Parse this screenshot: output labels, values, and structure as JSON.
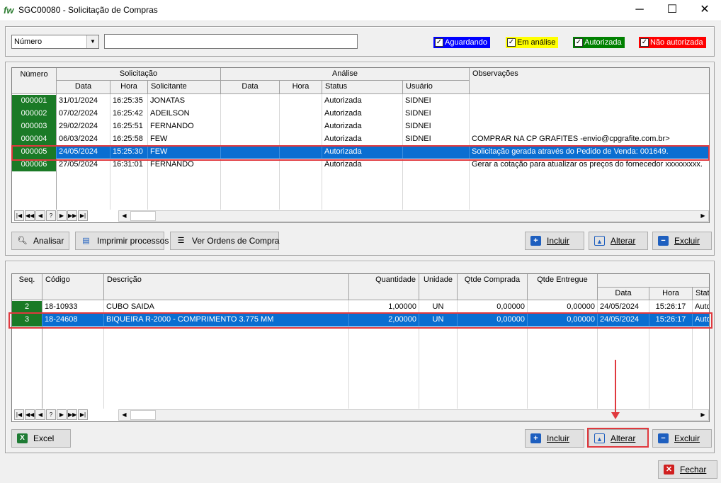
{
  "window": {
    "logo": "fw",
    "title": "SGC00080 - Solicitação de Compras",
    "minimize_glyph": "─",
    "maximize_glyph": "☐",
    "close_glyph": "✕"
  },
  "filter": {
    "field_select": "Número",
    "search_value": "",
    "statuses": [
      {
        "label": "Aguardando",
        "checked": true,
        "bg": "#0000ff",
        "fg": "#ffffff"
      },
      {
        "label": "Em análise",
        "checked": true,
        "bg": "#ffff00",
        "fg": "#000000"
      },
      {
        "label": "Autorizada",
        "checked": true,
        "bg": "#008000",
        "fg": "#ffffff"
      },
      {
        "label": "Não autorizada",
        "checked": true,
        "bg": "#ff0000",
        "fg": "#ffffff"
      }
    ]
  },
  "requests_grid": {
    "group_headers": {
      "numero": "Número",
      "solicitacao": "Solicitação",
      "analise": "Análise",
      "observacoes": "Observações"
    },
    "sub_headers": {
      "data": "Data",
      "hora": "Hora",
      "solicitante": "Solicitante",
      "an_data": "Data",
      "an_hora": "Hora",
      "status": "Status",
      "usuario": "Usuário"
    },
    "rows": [
      {
        "numero": "000001",
        "data": "31/01/2024",
        "hora": "16:25:35",
        "solicitante": "JONATAS",
        "an_data": "",
        "an_hora": "",
        "status": "Autorizada",
        "usuario": "SIDNEI",
        "obs": ""
      },
      {
        "numero": "000002",
        "data": "07/02/2024",
        "hora": "16:25:42",
        "solicitante": "ADEILSON",
        "an_data": "",
        "an_hora": "",
        "status": "Autorizada",
        "usuario": "SIDNEI",
        "obs": ""
      },
      {
        "numero": "000003",
        "data": "29/02/2024",
        "hora": "16:25:51",
        "solicitante": "FERNANDO",
        "an_data": "",
        "an_hora": "",
        "status": "Autorizada",
        "usuario": "SIDNEI",
        "obs": ""
      },
      {
        "numero": "000004",
        "data": "06/03/2024",
        "hora": "16:25:58",
        "solicitante": "FEW",
        "an_data": "",
        "an_hora": "",
        "status": "Autorizada",
        "usuario": "SIDNEI",
        "obs": "COMPRAR NA CP GRAFITES -envio@cpgrafite.com.br>"
      },
      {
        "numero": "000005",
        "data": "24/05/2024",
        "hora": "15:25:30",
        "solicitante": "FEW",
        "an_data": "",
        "an_hora": "",
        "status": "Autorizada",
        "usuario": "",
        "obs": "Solicitação gerada através do Pedido de Venda: 001649."
      },
      {
        "numero": "000006",
        "data": "27/05/2024",
        "hora": "16:31:01",
        "solicitante": "FERNANDO",
        "an_data": "",
        "an_hora": "",
        "status": "Autorizada",
        "usuario": "",
        "obs": "Gerar a cotação para atualizar os preços do fornecedor xxxxxxxxx."
      }
    ]
  },
  "nav_glyphs": [
    "|◀",
    "◀◀",
    "◀",
    "?",
    "▶",
    "▶▶",
    "▶|"
  ],
  "scroll_glyphs": {
    "left": "◀",
    "right": "▶"
  },
  "top_buttons": {
    "analisar": "Analisar",
    "imprimir": "Imprimir processos",
    "ver_ordens": "Ver Ordens de Compra",
    "incluir": "Incluir",
    "alterar": "Alterar",
    "excluir": "Excluir"
  },
  "items_grid": {
    "headers": {
      "seq": "Seq.",
      "codigo": "Código",
      "descricao": "Descrição",
      "quantidade": "Quantidade",
      "unidade": "Unidade",
      "qtde_comprada": "Qtde Comprada",
      "qtde_entregue": "Qtde Entregue",
      "data": "Data",
      "hora": "Hora",
      "status": "Stat"
    },
    "rows": [
      {
        "seq": "2",
        "codigo": "18-10933",
        "descricao": "CUBO SAIDA",
        "quantidade": "1,00000",
        "unidade": "UN",
        "qtde_comprada": "0,00000",
        "qtde_entregue": "0,00000",
        "data": "24/05/2024",
        "hora": "15:26:17",
        "status": "Auto"
      },
      {
        "seq": "3",
        "codigo": "18-24608",
        "descricao": "BIQUEIRA R-2000 - COMPRIMENTO 3.775 MM",
        "quantidade": "2,00000",
        "unidade": "UN",
        "qtde_comprada": "0,00000",
        "qtde_entregue": "0,00000",
        "data": "24/05/2024",
        "hora": "15:26:17",
        "status": "Auto"
      }
    ]
  },
  "bottom_buttons": {
    "excel": "Excel",
    "incluir": "Incluir",
    "alterar": "Alterar",
    "excluir": "Excluir",
    "fechar": "Fechar"
  },
  "icons": {
    "analisar": "magnifier-icon",
    "imprimir": "printer-icon",
    "ver_ordens": "list-icon",
    "incluir": "plus-icon",
    "alterar": "edit-icon",
    "excluir": "minus-icon",
    "excel": "excel-icon",
    "fechar": "close-icon"
  },
  "colors": {
    "selection": "#0a6ed1",
    "key_cell": "#1a7a26",
    "highlight": "#e0393e"
  }
}
